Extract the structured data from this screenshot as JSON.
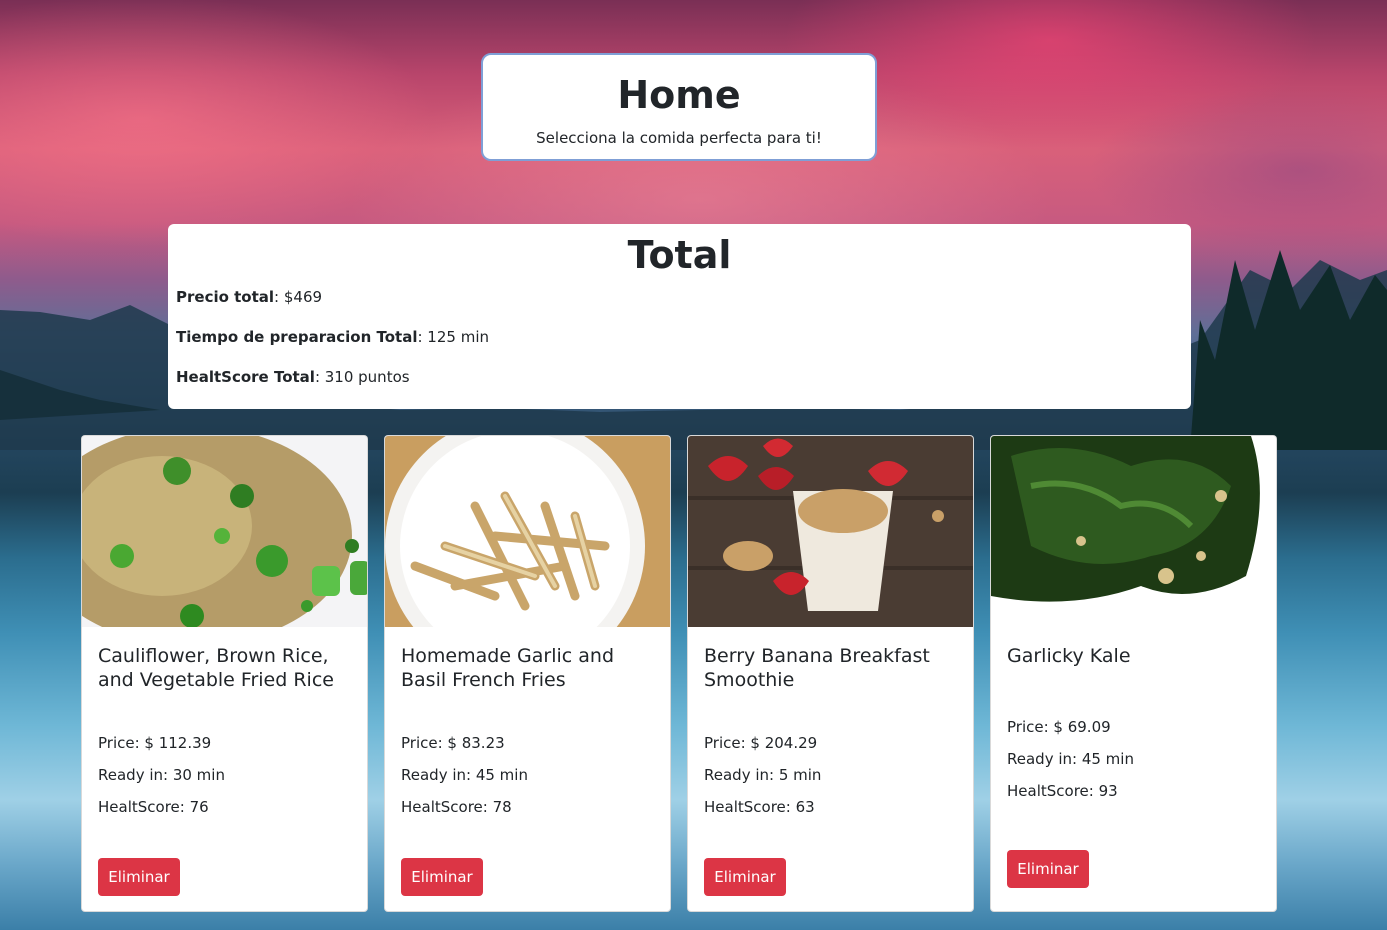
{
  "header": {
    "title": "Home",
    "subtitle": "Selecciona la comida perfecta para ti!"
  },
  "total": {
    "heading": "Total",
    "price_label": "Precio total",
    "price_value": ": $469",
    "time_label": "Tiempo de preparacion Total",
    "time_value": ": 125 min",
    "health_label": "HealtScore Total",
    "health_value": ": 310 puntos"
  },
  "cards": [
    {
      "title": "Cauliflower, Brown Rice, and Vegetable Fried Rice",
      "price": "Price: $ 112.39",
      "ready": "Ready in: 30 min",
      "health": "HealtScore: 76",
      "button": "Eliminar",
      "image": "fried-rice-photo"
    },
    {
      "title": "Homemade Garlic and Basil French Fries",
      "price": "Price: $ 83.23",
      "ready": "Ready in: 45 min",
      "health": "HealtScore: 78",
      "button": "Eliminar",
      "image": "french-fries-photo"
    },
    {
      "title": "Berry Banana Breakfast Smoothie",
      "price": "Price: $ 204.29",
      "ready": "Ready in: 5 min",
      "health": "HealtScore: 63",
      "button": "Eliminar",
      "image": "smoothie-photo"
    },
    {
      "title": "Garlicky Kale",
      "price": "Price: $ 69.09",
      "ready": "Ready in: 45 min",
      "health": "HealtScore: 93",
      "button": "Eliminar",
      "image": "kale-photo"
    }
  ],
  "colors": {
    "danger": "#dc3545",
    "header_border": "#7f9fd6"
  }
}
